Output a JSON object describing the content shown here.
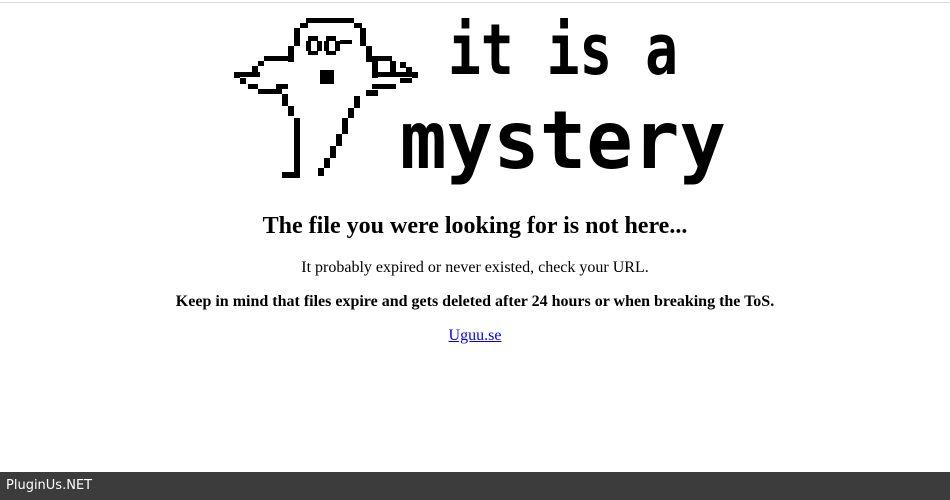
{
  "hero": {
    "mascot_icon": "pixel-ghost-icon",
    "line1": "it is a",
    "line2": "mystery"
  },
  "message": {
    "headline": "The file you were looking for is not here...",
    "subtext": "It probably expired or never existed, check your URL.",
    "notice": "Keep in mind that files expire and gets deleted after 24 hours or when breaking the ToS."
  },
  "home_link": {
    "label": "Uguu.se"
  },
  "footer": {
    "brand": "PluginUs.NET"
  },
  "colors": {
    "background": "#ffffff",
    "text": "#000000",
    "link": "#0000ee",
    "footer_bar": "#3c3c3c",
    "footer_text": "#ffffff"
  }
}
